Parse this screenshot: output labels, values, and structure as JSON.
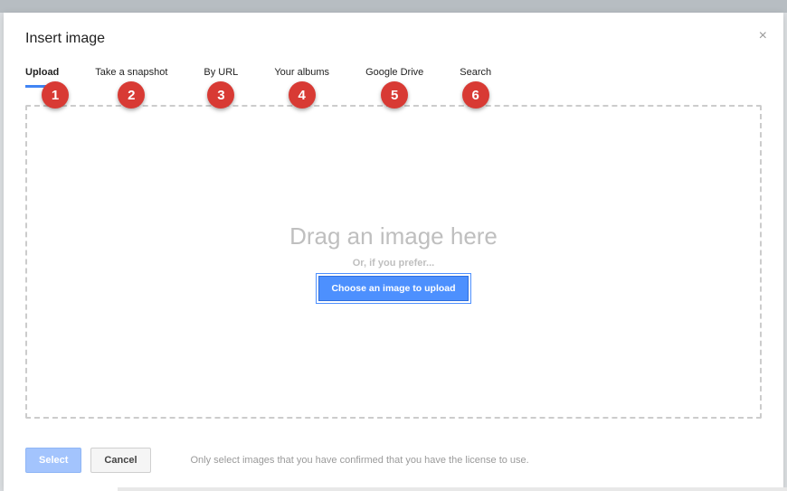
{
  "modal": {
    "title": "Insert image"
  },
  "tabs": [
    {
      "label": "Upload",
      "badge": "1"
    },
    {
      "label": "Take a snapshot",
      "badge": "2"
    },
    {
      "label": "By URL",
      "badge": "3"
    },
    {
      "label": "Your albums",
      "badge": "4"
    },
    {
      "label": "Google Drive",
      "badge": "5"
    },
    {
      "label": "Search",
      "badge": "6"
    }
  ],
  "dropzone": {
    "main_text": "Drag an image here",
    "sub_text": "Or, if you prefer...",
    "button_label": "Choose an image to upload"
  },
  "footer": {
    "select_label": "Select",
    "cancel_label": "Cancel",
    "hint": "Only select images that you have confirmed that you have the license to use."
  },
  "close": "×"
}
